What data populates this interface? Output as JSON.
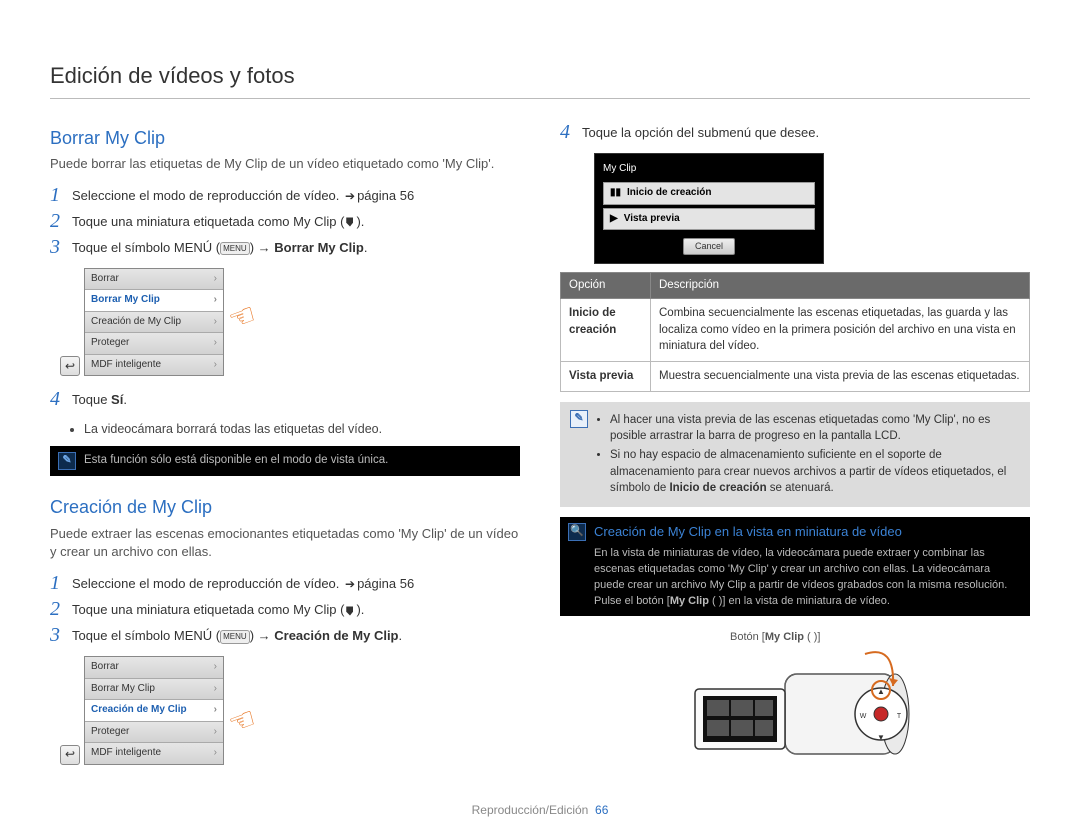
{
  "page_title": "Edición de vídeos y fotos",
  "footer_section": "Reproducción/Edición",
  "footer_page": "66",
  "left": {
    "sec1_heading": "Borrar My Clip",
    "sec1_intro": "Puede borrar las etiquetas de My Clip de un vídeo etiquetado como 'My Clip'.",
    "sec1_steps": {
      "s1": "Seleccione el modo de reproducción de vídeo. ",
      "s1_ref": "página 56",
      "s2a": "Toque una miniatura etiquetada como My Clip (",
      "s2b": ").",
      "s3a": "Toque el símbolo MENÚ (",
      "s3b": ") → ",
      "s3_bold": "Borrar My Clip",
      "s4a": "Toque ",
      "s4_bold": "Sí"
    },
    "sec1_bullet": "La videocámara borrará todas las etiquetas del vídeo.",
    "sec1_note": "Esta función sólo está disponible en el modo de vista única.",
    "menu_items": {
      "m0": "Borrar",
      "m1": "Borrar My Clip",
      "m2": "Creación de My Clip",
      "m3": "Proteger",
      "m4": "MDF inteligente"
    },
    "sec2_heading": "Creación de My Clip",
    "sec2_intro": "Puede extraer las escenas emocionantes etiquetadas como 'My Clip' de un vídeo y crear un archivo con ellas.",
    "sec2_steps": {
      "s1": "Seleccione el modo de reproducción de vídeo. ",
      "s1_ref": "página 56",
      "s2a": "Toque una miniatura etiquetada como My Clip (",
      "s2b": ").",
      "s3a": "Toque el símbolo MENÚ (",
      "s3b": ") → ",
      "s3_bold": "Creación de My Clip"
    }
  },
  "right": {
    "step4": "Toque la opción del submenú que desee.",
    "lcd_title": "My Clip",
    "lcd_row1": "Inicio de creación",
    "lcd_row2": "Vista previa",
    "lcd_cancel": "Cancel",
    "table_h1": "Opción",
    "table_h2": "Descripción",
    "row1_key": "Inicio de creación",
    "row1_val": "Combina secuencialmente las escenas etiquetadas, las guarda y las localiza como vídeo en la primera posición del archivo en una vista en miniatura del vídeo.",
    "row2_key": "Vista previa",
    "row2_val": "Muestra secuencialmente una vista previa de las escenas etiquetadas.",
    "grey_note_1": "Al hacer una vista previa de las escenas etiquetadas como 'My Clip', no es posible arrastrar la barra de progreso en la pantalla LCD.",
    "grey_note_2a": "Si no hay espacio de almacenamiento suficiente en el soporte de almacenamiento para crear nuevos archivos a partir de vídeos etiquetados, el símbolo de ",
    "grey_note_2_bold": "Inicio de creación",
    "grey_note_2b": " se atenuará.",
    "black_note_title": "Creación de My Clip en la vista en miniatura de vídeo",
    "black_note_body_a": "En la vista de miniaturas de vídeo, la videocámara puede extraer y combinar las escenas etiquetadas como 'My Clip' y crear un archivo con ellas. La videocámara puede crear un archivo My Clip a partir de vídeos grabados con la misma resolución. Pulse el botón [",
    "black_note_body_bold": "My Clip",
    "black_note_body_b": " ( )] en la vista de miniatura de vídeo.",
    "cam_label_a": "Botón [",
    "cam_label_bold": "My Clip",
    "cam_label_b": " ( )]"
  },
  "icons": {
    "menu_chip": "MENU"
  }
}
